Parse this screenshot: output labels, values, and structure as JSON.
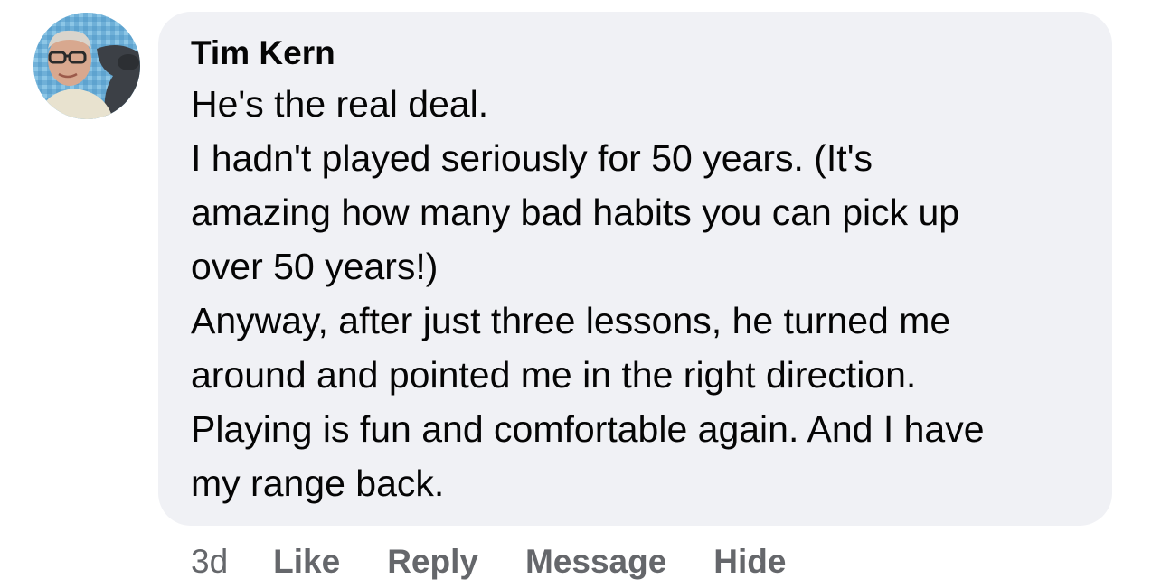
{
  "comment": {
    "author": "Tim Kern",
    "lines": [
      "He's the real deal.",
      "I hadn't played seriously for 50 years. (It's",
      "amazing how many bad habits you can pick up",
      "over 50 years!)",
      "Anyway, after just three lessons, he turned me",
      "around and pointed me in the right direction.",
      "Playing is fun and comfortable again. And I have",
      "my range back."
    ],
    "timestamp": "3d",
    "actions": {
      "like": "Like",
      "reply": "Reply",
      "message": "Message",
      "hide": "Hide"
    }
  },
  "colors": {
    "bubble_background": "#f0f1f5",
    "text": "#050505",
    "secondary_text": "#65676b"
  }
}
